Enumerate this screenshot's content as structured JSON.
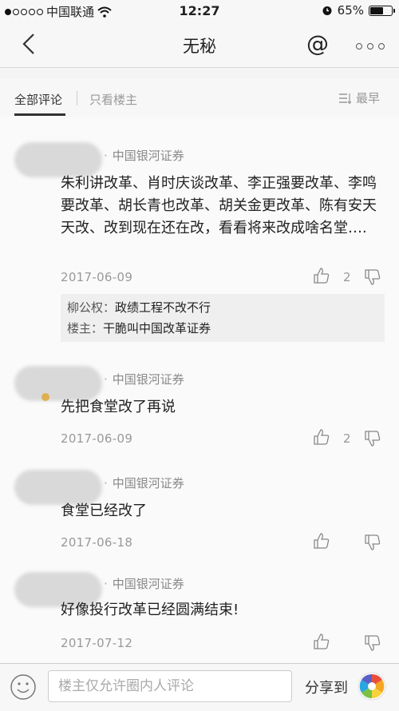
{
  "status_bar": {
    "carrier": "中国联通",
    "time": "12:27",
    "battery": "65%",
    "battery_level": 0.65
  },
  "nav": {
    "title": "无秘",
    "at_symbol": "@"
  },
  "filter": {
    "tab_all": "全部评论",
    "tab_owner": "只看楼主",
    "sort": "最早"
  },
  "comments": [
    {
      "org": "中国银河证券",
      "text": "朱利讲改革、肖时庆谈改革、李正强要改革、李鸣要改革、胡长青也改革、胡关金更改革、陈有安天天改、改到现在还在改，看看将来改成啥名堂….",
      "date": "2017-06-09",
      "likes": "2",
      "replies": [
        {
          "name": "柳公权：",
          "text": "政绩工程不改不行"
        },
        {
          "name": "楼主：",
          "text": "干脆叫中国改革证券"
        }
      ]
    },
    {
      "org": "中国银河证券",
      "text": "先把食堂改了再说",
      "date": "2017-06-09",
      "likes": "2"
    },
    {
      "org": "中国银河证券",
      "text": "食堂已经改了",
      "date": "2017-06-18",
      "likes": ""
    },
    {
      "org": "中国银河证券",
      "text": "好像投行改革已经圆满结束!",
      "date": "2017-07-12",
      "likes": ""
    }
  ],
  "bottom": {
    "placeholder": "楼主仅允许圈内人评论",
    "share": "分享到"
  }
}
